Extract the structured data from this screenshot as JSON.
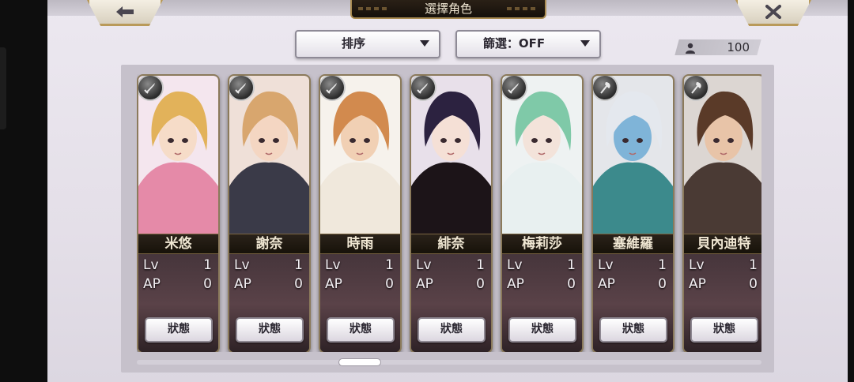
{
  "window": {
    "title": "選擇角色"
  },
  "top_bar": {
    "back_icon": "left-arrow-icon",
    "close_icon": "close-x-icon"
  },
  "filters": {
    "sort_label": "排序",
    "filter_label": "篩選：OFF"
  },
  "character_count": {
    "icon": "person-icon",
    "value": "100"
  },
  "cards": [
    {
      "name": "米悠",
      "lv_label": "Lv",
      "lv": "1",
      "ap_label": "AP",
      "ap": "0",
      "status_label": "狀態",
      "weapon_icon": "sword-icon"
    },
    {
      "name": "謝奈",
      "lv_label": "Lv",
      "lv": "1",
      "ap_label": "AP",
      "ap": "0",
      "status_label": "狀態",
      "weapon_icon": "sword-icon"
    },
    {
      "name": "時雨",
      "lv_label": "Lv",
      "lv": "1",
      "ap_label": "AP",
      "ap": "0",
      "status_label": "狀態",
      "weapon_icon": "sword-icon"
    },
    {
      "name": "緋奈",
      "lv_label": "Lv",
      "lv": "1",
      "ap_label": "AP",
      "ap": "0",
      "status_label": "狀態",
      "weapon_icon": "sword-icon"
    },
    {
      "name": "梅莉莎",
      "lv_label": "Lv",
      "lv": "1",
      "ap_label": "AP",
      "ap": "0",
      "status_label": "狀態",
      "weapon_icon": "sword-icon"
    },
    {
      "name": "塞維羅",
      "lv_label": "Lv",
      "lv": "1",
      "ap_label": "AP",
      "ap": "0",
      "status_label": "狀態",
      "weapon_icon": "axe-icon"
    },
    {
      "name": "貝內迪特",
      "lv_label": "Lv",
      "lv": "1",
      "ap_label": "AP",
      "ap": "0",
      "status_label": "狀態",
      "weapon_icon": "axe-icon"
    }
  ],
  "colors": {
    "hair": [
      "#e2b25a",
      "#d8a66e",
      "#d28a4e",
      "#2c2240",
      "#7fc9a8",
      "#e4e8ee",
      "#5a3a28"
    ],
    "outfit": [
      "#e58aa8",
      "#3a3a48",
      "#f0e8dc",
      "#1c1418",
      "#e8f0f0",
      "#3c8a8c",
      "#4a3a34"
    ],
    "skin": [
      "#f6dcc8",
      "#f4d6c2",
      "#f1d0b4",
      "#f5e0d6",
      "#f3e3da",
      "#7fb4d8",
      "#e8c4a8"
    ],
    "bg": [
      "#f4e6ee",
      "#efe0d8",
      "#f6f2ec",
      "#e8e0ea",
      "#eef2f2",
      "#e4e6ea",
      "#dcd6d2"
    ]
  }
}
